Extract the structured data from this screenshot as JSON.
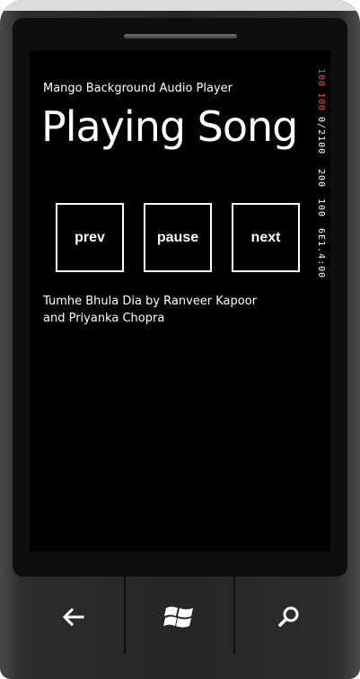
{
  "app": {
    "name": "Mango Background Audio Player",
    "page_title": "Playing Song"
  },
  "controls": {
    "prev_label": "prev",
    "pause_label": "pause",
    "next_label": "next"
  },
  "now_playing": {
    "text": "Tumhe Bhula Dia by Ranveer Kapoor and Priyanka Chopra"
  },
  "debug_counters": [
    {
      "text": "100",
      "color": "#ff4a1a"
    },
    {
      "text": "100",
      "color": "#ff4a1a"
    },
    {
      "text": "0/2100",
      "color": "#ffffff"
    },
    {
      "text": "200",
      "color": "#ffffff"
    },
    {
      "text": "100",
      "color": "#ffffff"
    },
    {
      "text": "6E1.4:00",
      "color": "#ffffff"
    }
  ],
  "hardware_buttons": {
    "back": "back-arrow-icon",
    "start": "windows-logo-icon",
    "search": "search-icon"
  },
  "colors": {
    "background": "#000000",
    "foreground": "#ffffff",
    "accent_counter": "#ff4a1a"
  }
}
